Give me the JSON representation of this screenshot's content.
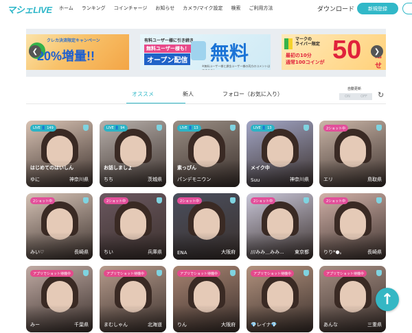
{
  "header": {
    "logo": "マシェLIVE",
    "nav": [
      "ホーム",
      "ランキング",
      "コインチャージ",
      "お知らせ",
      "カメラ/マイク設定",
      "検索",
      "ご利用方法"
    ],
    "download": "ダウンロード",
    "register": "新規登録"
  },
  "banners": {
    "b1": {
      "line1": "クレカ決済限定キャンペーン",
      "line2": "20%増量!!"
    },
    "b2": {
      "line1": "有料ユーザー様に引き続き",
      "line2": "無料ユーザー様も！",
      "line3": "オープン配信",
      "big": "無料",
      "note": "※無料ユーザー様と課金ユーザー様の両方のコメントはできません"
    },
    "b3": {
      "line1": "マークの",
      "line1b": "ライバー限定",
      "line2": "最初の10分",
      "line3": "通常100コインが",
      "big": "50",
      "tail": "話せ"
    }
  },
  "tabs": {
    "items": [
      "オススメ",
      "新人",
      "フォロー（お気に入り）"
    ],
    "active": 0,
    "auto_label": "自動更新",
    "on": "ON",
    "off": "OFF"
  },
  "cards": [
    {
      "tag": "LIVE 👤 149",
      "tag_type": "live",
      "catch": "はじめてのはいしん",
      "name": "ゆに",
      "pref": "神奈川県",
      "bg": "#d9c3b4"
    },
    {
      "tag": "LIVE 👤 94",
      "tag_type": "live",
      "catch": "お話しましょ",
      "name": "ちち",
      "pref": "茨城県",
      "bg": "#b9b1ac"
    },
    {
      "tag": "LIVE 👤 13",
      "tag_type": "live",
      "catch": "素っぴん",
      "name": "パンデモニウン",
      "pref": "",
      "bg": "#9a8e84"
    },
    {
      "tag": "LIVE 👤 13",
      "tag_type": "live",
      "catch": "メイク中",
      "name": "Suu",
      "pref": "神奈川県",
      "bg": "#a2a6c6"
    },
    {
      "tag": "2ショット中",
      "tag_type": "shot",
      "catch": "",
      "name": "エリ",
      "pref": "鳥取県",
      "bg": "#cbb6a8"
    },
    {
      "tag": "2ショット中",
      "tag_type": "shot",
      "catch": "",
      "name": "みい♡",
      "pref": "長崎県",
      "bg": "#d6c3b6"
    },
    {
      "tag": "2ショット中",
      "tag_type": "shot",
      "catch": "",
      "name": "ちい",
      "pref": "兵庫県",
      "bg": "#6b5860"
    },
    {
      "tag": "2ショット中",
      "tag_type": "shot",
      "catch": "",
      "name": "ENA",
      "pref": "大阪府",
      "bg": "#4a4f5e"
    },
    {
      "tag": "2ショット中",
      "tag_type": "shot",
      "catch": "",
      "name": "///みみ＿みみ...",
      "pref": "東京都",
      "bg": "#c9c7d9"
    },
    {
      "tag": "2ショット中",
      "tag_type": "shot",
      "catch": "",
      "name": "りり*●。",
      "pref": "長崎県",
      "bg": "#d1b1a8"
    },
    {
      "tag": "アプリでショット待機中",
      "tag_type": "app",
      "catch": "",
      "name": "みー",
      "pref": "千葉県",
      "bg": "#c0aba4"
    },
    {
      "tag": "アプリでショット待機中",
      "tag_type": "app",
      "catch": "",
      "name": "まむしゃん",
      "pref": "北海道",
      "bg": "#b79c8d"
    },
    {
      "tag": "アプリでショット待機中",
      "tag_type": "app",
      "catch": "",
      "name": "りん",
      "pref": "大阪府",
      "bg": "#a88472"
    },
    {
      "tag": "アプリでショット待機中",
      "tag_type": "app",
      "catch": "",
      "name": "💎レイナ💎",
      "pref": "",
      "bg": "#b2927e"
    },
    {
      "tag": "アプリでショット待機中",
      "tag_type": "app",
      "catch": "",
      "name": "あんな",
      "pref": "三重県",
      "bg": "#a58e83"
    }
  ],
  "scroll_top_icon": "↑"
}
